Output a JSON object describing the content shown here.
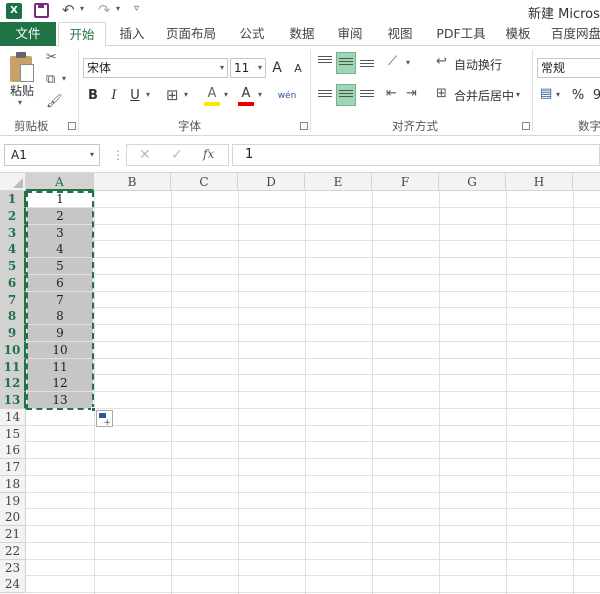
{
  "window": {
    "title": "新建 Microso"
  },
  "quick_access": {
    "logo_letter": "X",
    "undo_icon": "undo-icon",
    "redo_icon": "redo-icon"
  },
  "tabs": [
    {
      "label": "文件"
    },
    {
      "label": "开始"
    },
    {
      "label": "插入"
    },
    {
      "label": "页面布局"
    },
    {
      "label": "公式"
    },
    {
      "label": "数据"
    },
    {
      "label": "审阅"
    },
    {
      "label": "视图"
    },
    {
      "label": "PDF工具"
    },
    {
      "label": "模板"
    },
    {
      "label": "百度网盘"
    }
  ],
  "ribbon": {
    "clipboard": {
      "paste_label": "粘贴",
      "group_label": "剪贴板"
    },
    "font": {
      "font_name": "宋体",
      "font_size": "11",
      "grow": "A",
      "shrink": "A",
      "bold": "B",
      "italic": "I",
      "underline": "U",
      "highlight": "A",
      "font_color": "A",
      "phonetic": "wén",
      "group_label": "字体"
    },
    "alignment": {
      "wrap_text": "自动换行",
      "merge_center": "合并后居中",
      "group_label": "对齐方式"
    },
    "number": {
      "format": "常规",
      "percent": "%",
      "comma": "9",
      "group_label": "数字"
    }
  },
  "formula_bar": {
    "name_box": "A1",
    "fx": "fx",
    "content": "1"
  },
  "sheet": {
    "columns": [
      "A",
      "B",
      "C",
      "D",
      "E",
      "F",
      "G",
      "H"
    ],
    "rows": [
      "1",
      "2",
      "3",
      "4",
      "5",
      "6",
      "7",
      "8",
      "9",
      "10",
      "11",
      "12",
      "13",
      "14",
      "15",
      "16",
      "17",
      "18",
      "19",
      "20",
      "21",
      "22",
      "23",
      "24"
    ],
    "column_a_values": [
      "1",
      "2",
      "3",
      "4",
      "5",
      "6",
      "7",
      "8",
      "9",
      "10",
      "11",
      "12",
      "13"
    ],
    "selected_range": "A1:A13"
  }
}
